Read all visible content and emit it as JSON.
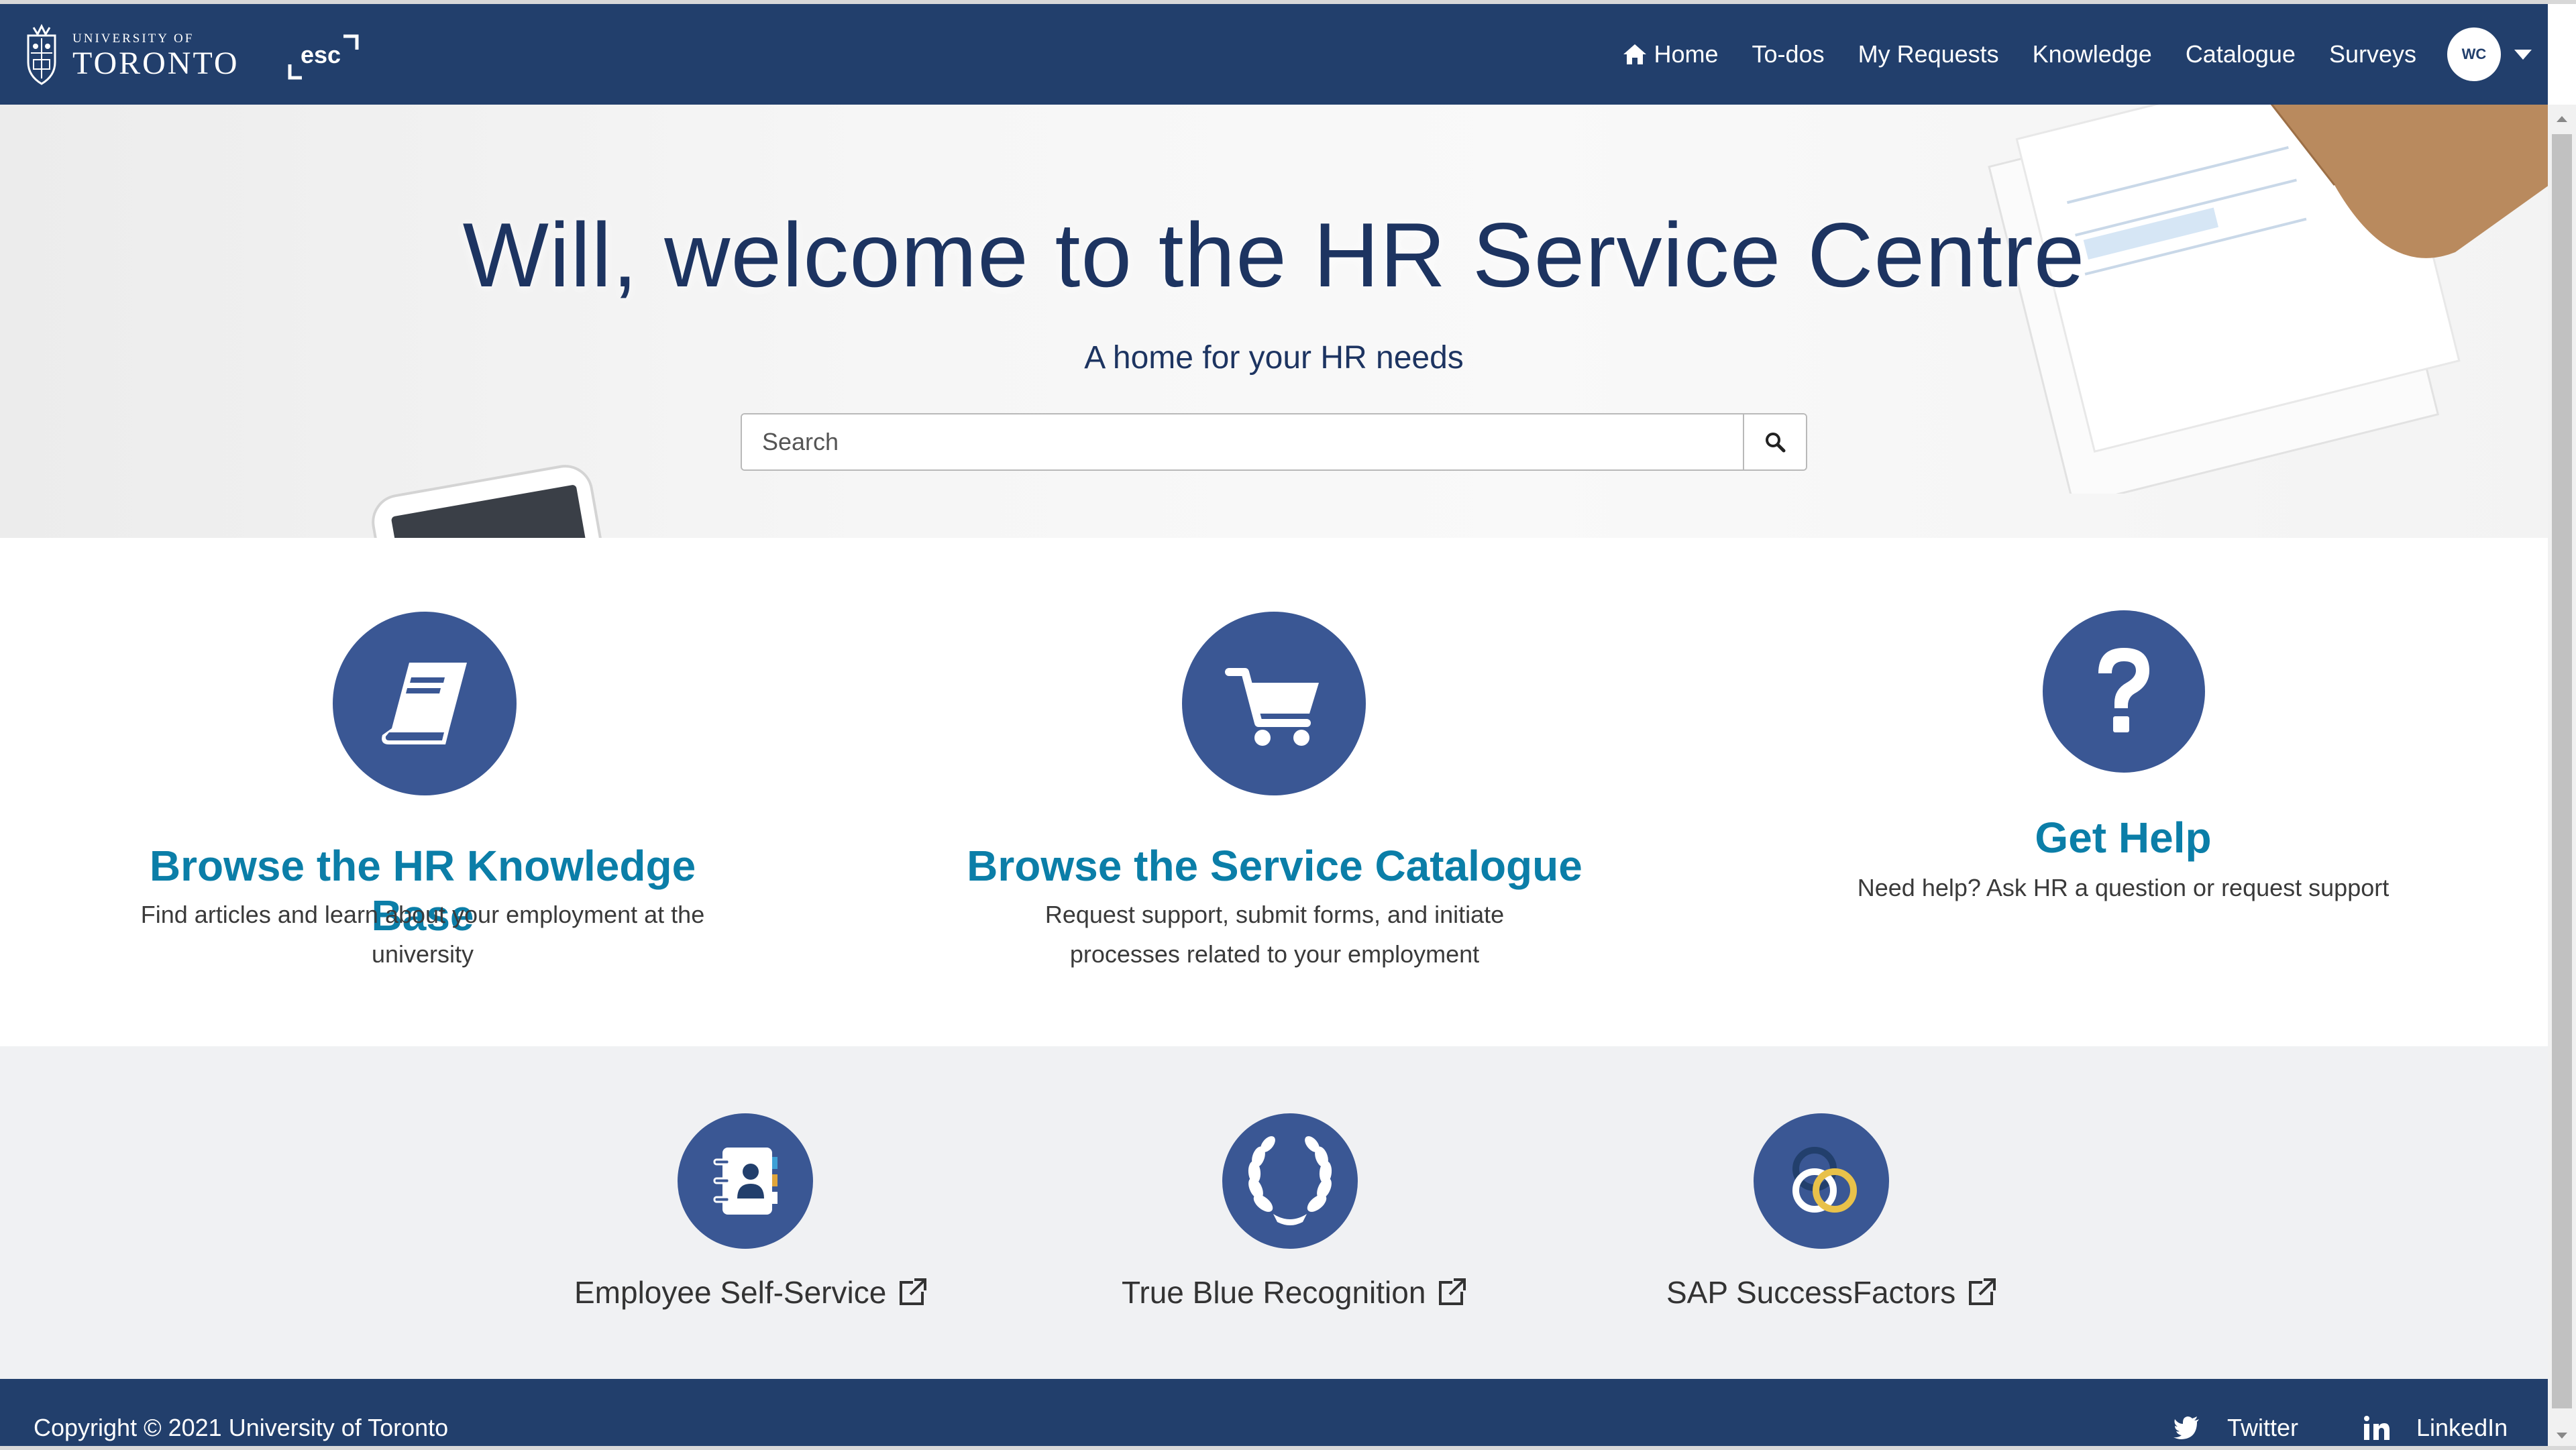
{
  "brand": {
    "university_small": "UNIVERSITY OF",
    "university_big": "TORONTO",
    "esc_logo": "esc"
  },
  "nav": {
    "home": "Home",
    "todos": "To-dos",
    "my_requests": "My Requests",
    "knowledge": "Knowledge",
    "catalogue": "Catalogue",
    "surveys": "Surveys",
    "avatar_initials": "WC"
  },
  "hero": {
    "title": "Will, welcome to the HR Service Centre",
    "subtitle": "A home for your HR needs",
    "search_placeholder": "Search"
  },
  "cards": {
    "knowledge": {
      "icon": "book-icon",
      "title": "Browse the HR Knowledge Base",
      "desc_line1": "Find articles and learn about your employment at the",
      "desc_line2": "university"
    },
    "catalogue": {
      "icon": "cart-icon",
      "title": "Browse the Service Catalogue",
      "desc_line1": "Request support, submit forms, and initiate",
      "desc_line2": "processes related to your employment"
    },
    "help": {
      "icon": "question-icon",
      "title": "Get Help",
      "desc_line1": "Need help? Ask HR a question or request support"
    }
  },
  "quick_links": {
    "ess": {
      "icon": "address-book-icon",
      "label": "Employee Self-Service"
    },
    "tbr": {
      "icon": "laurel-wreath-icon",
      "label": "True Blue Recognition"
    },
    "sap": {
      "icon": "successfactors-icon",
      "label": "SAP SuccessFactors"
    }
  },
  "footer": {
    "copyright": "Copyright © 2021 University of Toronto",
    "twitter": "Twitter",
    "linkedin": "LinkedIn"
  },
  "colors": {
    "navy": "#223f6c",
    "circle_blue": "#3a5794",
    "title_teal": "#0b7ea8",
    "hero_text": "#1d3461"
  }
}
